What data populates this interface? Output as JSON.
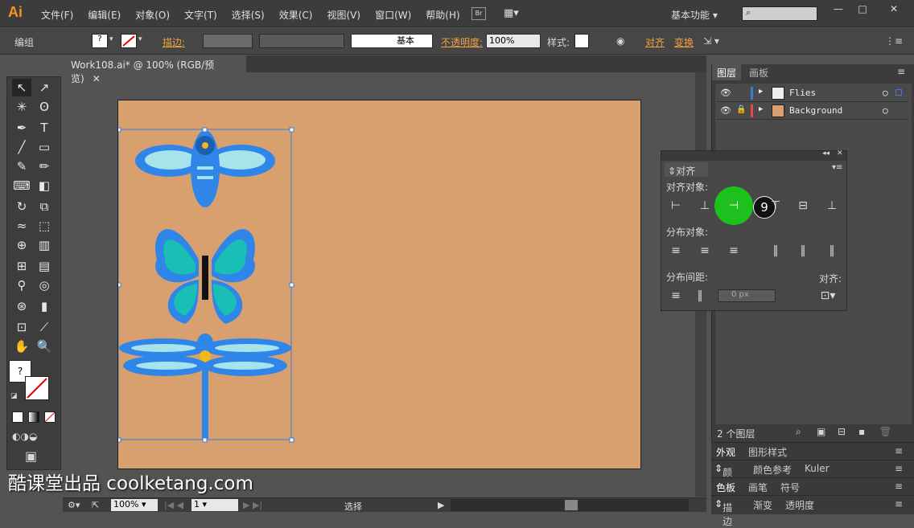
{
  "app": {
    "logo": "Ai",
    "menus": [
      "文件(F)",
      "编辑(E)",
      "对象(O)",
      "文字(T)",
      "选择(S)",
      "效果(C)",
      "视图(V)",
      "窗口(W)",
      "帮助(H)"
    ],
    "bridge": "Br",
    "workspace": "基本功能"
  },
  "control": {
    "selection": "编组",
    "stroke_label": "描边:",
    "stroke_style": "基本",
    "opacity_label": "不透明度:",
    "opacity_value": "100%",
    "style_label": "样式:",
    "align_label": "对齐",
    "transform_label": "变换"
  },
  "document": {
    "tab": "Work108.ai* @ 100% (RGB/预览)"
  },
  "status": {
    "zoom": "100%",
    "page": "1",
    "tool": "选择"
  },
  "layers": {
    "tabs": [
      "图层",
      "画板"
    ],
    "items": [
      {
        "name": "Flies",
        "color": "#3a7bd5"
      },
      {
        "name": "Background",
        "color": "#e04a4a"
      }
    ],
    "count": "2 个图层"
  },
  "align": {
    "title": "对齐",
    "align_objects": "对齐对象:",
    "distribute_objects": "分布对象:",
    "distribute_spacing": "分布间距:",
    "align_to": "对齐:",
    "spacing_value": "0 px",
    "step_badge": "9"
  },
  "lower_panels": {
    "row1": [
      "外观",
      "图形样式"
    ],
    "row2": [
      "颜色",
      "颜色参考",
      "Kuler"
    ],
    "row3": [
      "色板",
      "画笔",
      "符号"
    ],
    "row4": [
      "描边",
      "渐变",
      "透明度"
    ]
  },
  "watermark": "酷课堂出品 coolketang.com",
  "colors": {
    "artboard": "#d9a06f",
    "highlight": "#1fbf1f"
  }
}
